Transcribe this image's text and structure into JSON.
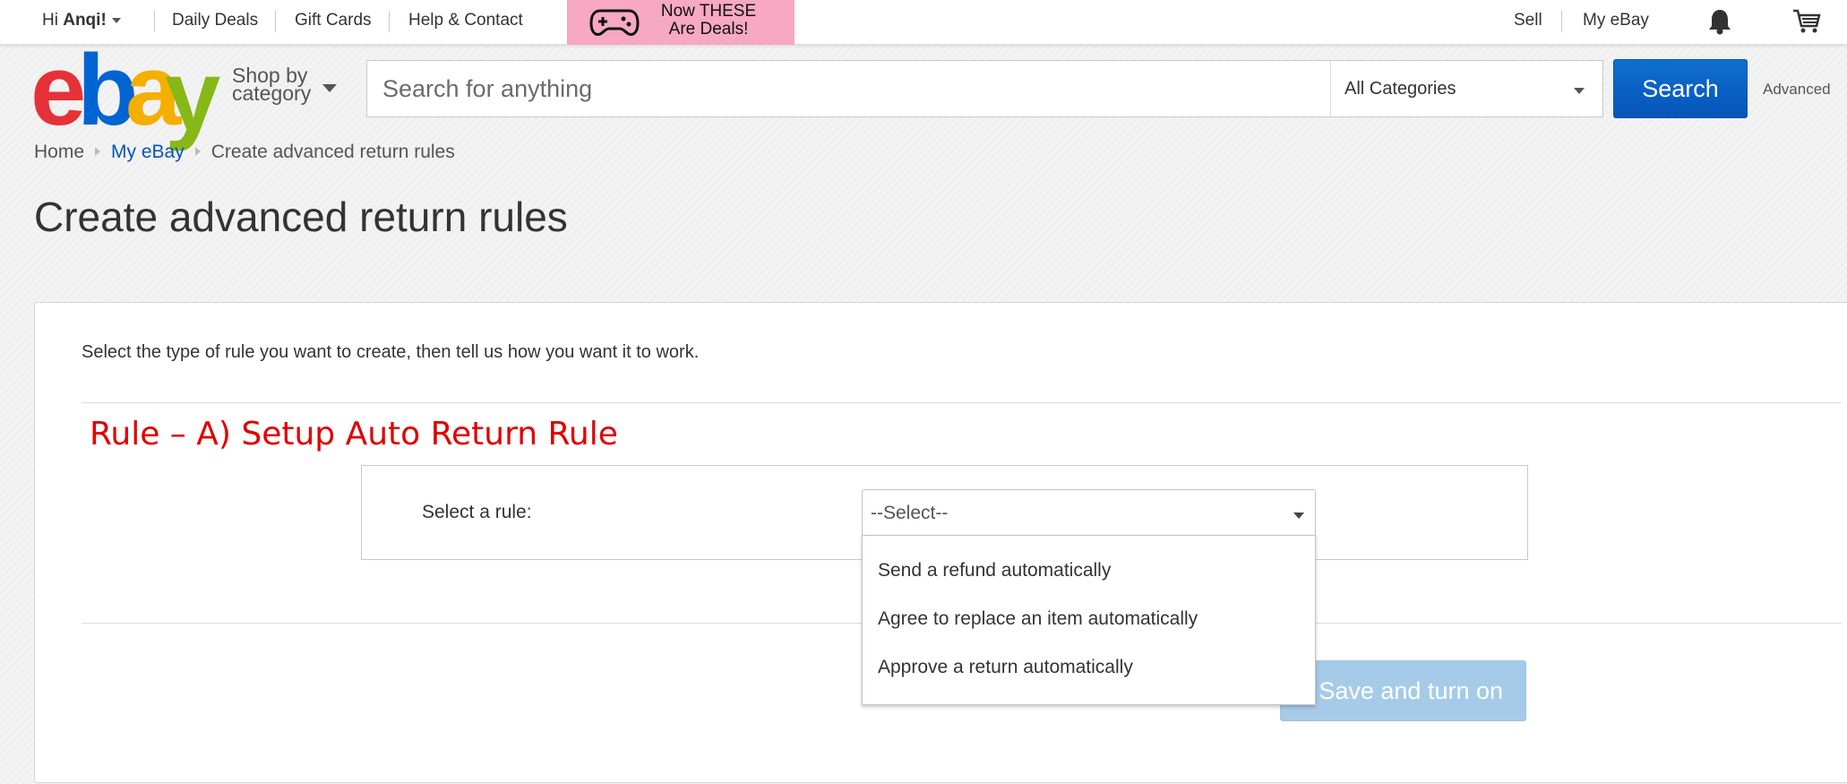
{
  "topbar": {
    "greeting_prefix": "Hi ",
    "user_name": "Anqi!",
    "links": [
      "Daily Deals",
      "Gift Cards",
      "Help & Contact"
    ],
    "promo_text": "Now THESE Are Deals!",
    "right_links": [
      "Sell",
      "My eBay"
    ],
    "bell_icon": "bell-icon",
    "cart_icon": "cart-icon"
  },
  "header": {
    "logo_letters": [
      "e",
      "b",
      "a",
      "y"
    ],
    "logo_colors": [
      "#e53238",
      "#0064d2",
      "#f5af02",
      "#86b817"
    ],
    "shop_by_line1": "Shop by",
    "shop_by_line2": "category",
    "search_placeholder": "Search for anything",
    "category_selected": "All Categories",
    "search_button": "Search",
    "advanced_link": "Advanced"
  },
  "breadcrumb": [
    "Home",
    "My eBay",
    "Create advanced return rules"
  ],
  "page_title": "Create advanced return rules",
  "main": {
    "intro": "Select the type of rule you want to create, then tell us how you want it to work.",
    "annotation": "Rule – A) Setup Auto Return Rule",
    "annotation_color": "#e00000",
    "rule_label": "Select a rule:",
    "select_value": "--Select--",
    "options": [
      "Send a refund automatically",
      "Agree to replace an item automatically",
      "Approve a return automatically"
    ],
    "save_button": "Save and turn on"
  }
}
